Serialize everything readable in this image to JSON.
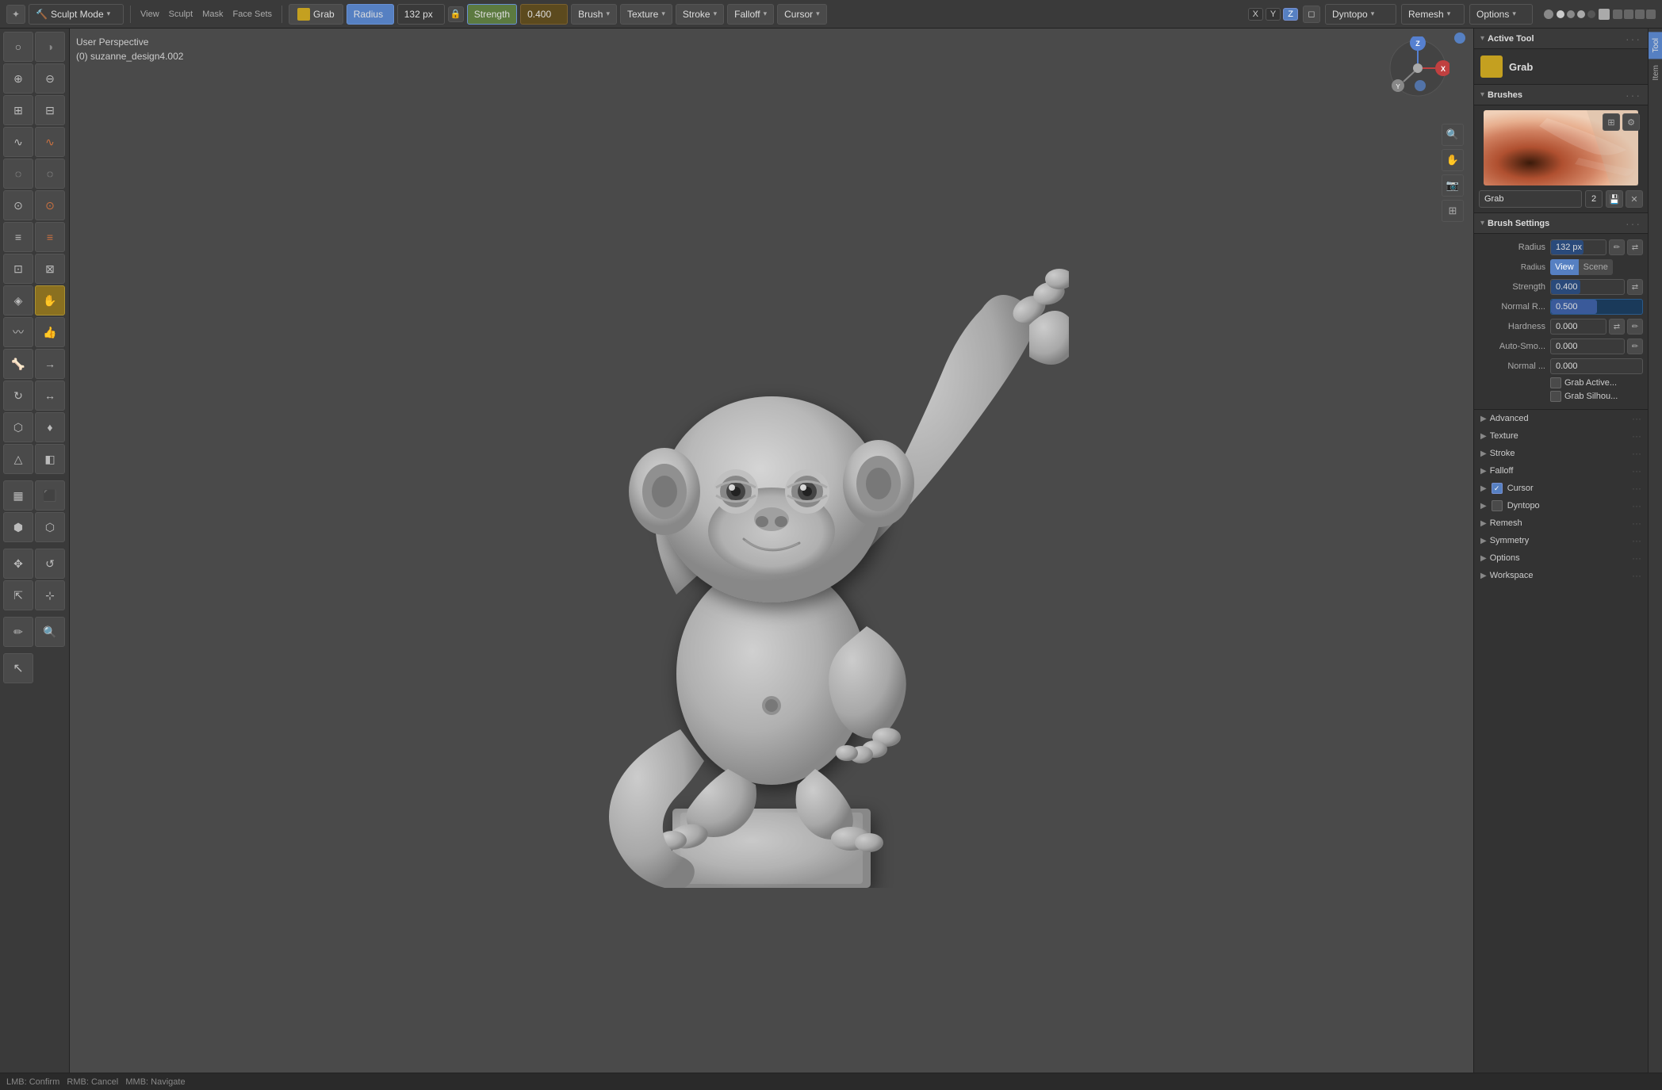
{
  "topbar": {
    "mode_icon": "✦",
    "mode_label": "Sculpt Mode",
    "menus": [
      "View",
      "Sculpt",
      "Mask",
      "Face Sets"
    ],
    "tool_name": "Grab",
    "radius_label": "Radius",
    "radius_value": "132 px",
    "strength_label": "Strength",
    "strength_value": "0.400",
    "brush_btn": "Brush",
    "texture_btn": "Texture",
    "stroke_btn": "Stroke",
    "falloff_btn": "Falloff",
    "cursor_btn": "Cursor",
    "dyntopo_label": "Dyntopo",
    "remesh_label": "Remesh",
    "options_label": "Options"
  },
  "viewport": {
    "perspective_label": "User Perspective",
    "object_name": "(0) suzanne_design4.002"
  },
  "right_panel": {
    "active_tool": {
      "header": "Active Tool",
      "tool_name": "Grab"
    },
    "brushes": {
      "header": "Brushes",
      "brush_name": "Grab",
      "brush_number": "2"
    },
    "brush_settings": {
      "header": "Brush Settings",
      "radius_label": "Radius",
      "radius_value": "132 px",
      "radius_unit_view": "View",
      "radius_unit_scene": "Scene",
      "strength_label": "Strength",
      "strength_value": "0.400",
      "normal_radius_label": "Normal R...",
      "normal_radius_value": "0.500",
      "hardness_label": "Hardness",
      "hardness_value": "0.000",
      "auto_smooth_label": "Auto-Smo...",
      "auto_smooth_value": "0.000",
      "normal_label": "Normal ...",
      "normal_value": "0.000",
      "grab_active_label": "Grab Active...",
      "grab_silhou_label": "Grab Silhou..."
    },
    "advanced": {
      "header": "Advanced"
    },
    "texture": {
      "header": "Texture"
    },
    "stroke": {
      "header": "Stroke"
    },
    "falloff": {
      "header": "Falloff"
    },
    "cursor": {
      "header": "Cursor",
      "checked": true
    },
    "dyntopo": {
      "header": "Dyntopo",
      "checked": false
    },
    "remesh": {
      "header": "Remesh"
    },
    "symmetry": {
      "header": "Symmetry"
    },
    "options": {
      "header": "Options"
    },
    "workspace": {
      "header": "Workspace"
    }
  },
  "side_tabs": {
    "tool_tab": "Tool",
    "item_tab": "Item"
  },
  "icons": {
    "chevron_right": "▶",
    "chevron_down": "▾",
    "checkbox_checked": "✓",
    "dots": "···"
  }
}
